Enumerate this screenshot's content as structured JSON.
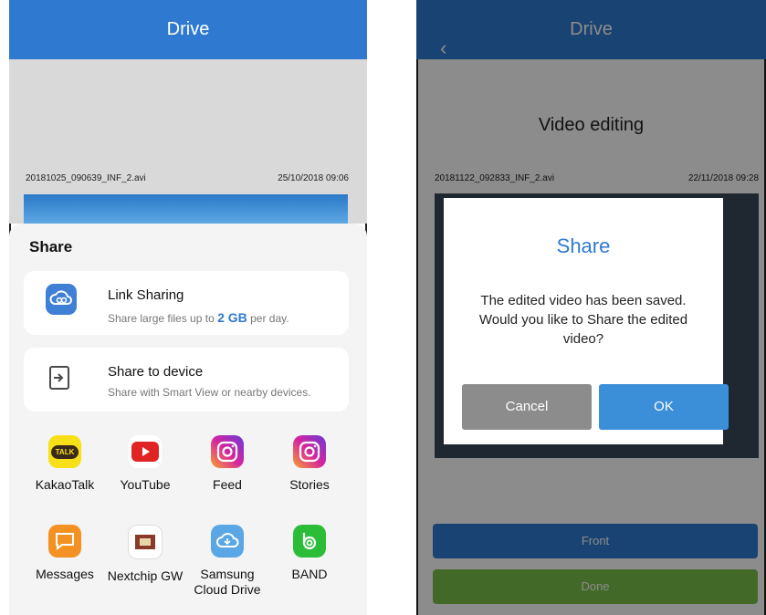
{
  "left": {
    "header": {
      "title": "Drive"
    },
    "video": {
      "filename": "20181025_090639_INF_2.avi",
      "timestamp": "25/10/2018 09:06"
    },
    "share_sheet": {
      "title": "Share",
      "link_sharing": {
        "label": "Link Sharing",
        "subtitle_prefix": "Share large files up to ",
        "subtitle_amount": "2 GB",
        "subtitle_suffix": " per day.",
        "icon": "cloud-link-icon"
      },
      "share_to_device": {
        "label": "Share to device",
        "subtitle": "Share with Smart View or nearby devices.",
        "icon": "share-device-icon"
      },
      "apps": [
        {
          "label": "KakaoTalk",
          "icon_text": "TALK",
          "icon": "kakaotalk-icon",
          "color": "#f7e017"
        },
        {
          "label": "YouTube",
          "icon_text": "",
          "icon": "youtube-icon",
          "color": "#e02424"
        },
        {
          "label": "Feed",
          "icon_text": "",
          "icon": "instagram-icon",
          "color": "#c13584"
        },
        {
          "label": "Stories",
          "icon_text": "",
          "icon": "instagram-icon",
          "color": "#c13584"
        },
        {
          "label": "Messages",
          "icon_text": "",
          "icon": "messages-icon",
          "color": "#f39222"
        },
        {
          "label": "Nextchip GW",
          "icon_text": "",
          "icon": "nextchip-icon",
          "color": "#ffffff"
        },
        {
          "label": "Samsung Cloud Drive",
          "label_line1": "Samsung",
          "label_line2": "Cloud Drive",
          "icon_text": "",
          "icon": "samsung-cloud-icon",
          "color": "#5aa7e6"
        },
        {
          "label": "BAND",
          "icon_text": "",
          "icon": "band-icon",
          "color": "#2bbd38"
        }
      ]
    }
  },
  "right": {
    "header": {
      "title": "Drive",
      "back_icon": "chevron-left-icon"
    },
    "section_title": "Video editing",
    "video": {
      "filename": "20181122_092833_INF_2.avi",
      "timestamp": "22/11/2018 09:28"
    },
    "dialog": {
      "title": "Share",
      "message": "The edited video has been saved. Would you like to Share the edited video?",
      "cancel_label": "Cancel",
      "ok_label": "OK"
    },
    "bottom_buttons": {
      "front_label": "Front",
      "done_label": "Done"
    }
  },
  "colors": {
    "primary_blue": "#2f7ad0",
    "done_green": "#7bbf4a",
    "cancel_gray": "#8c8c8c",
    "ok_blue": "#3b8ed8"
  }
}
